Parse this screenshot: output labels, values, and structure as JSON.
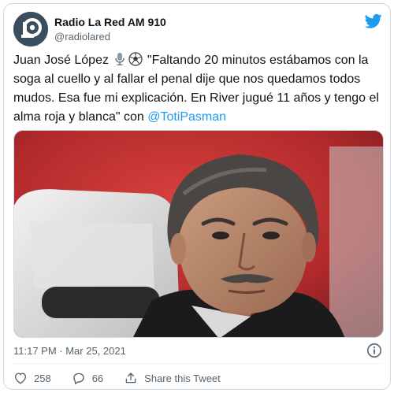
{
  "account": {
    "display_name": "Radio La Red AM 910",
    "handle": "@radiolared",
    "avatar_icon": "radio-la-red-logo",
    "brand_icon": "twitter-bird-icon"
  },
  "tweet": {
    "text_part1": "Juan José López",
    "text_part2": " \"Faltando 20 minutos estábamos con la soga al cuello y al fallar el penal dije que nos quedamos todos mudos. Esa fue mi explicación. En River jugué 11 años y tengo el alma roja y blanca\" con ",
    "mention": "@TotiPasman",
    "emoji": [
      "microphone-emoji",
      "soccer-ball-emoji"
    ]
  },
  "media": {
    "description_icon": "photo-of-man"
  },
  "meta": {
    "timestamp": "11:17 PM · Mar 25, 2021"
  },
  "actions": {
    "likes_count": "258",
    "replies_count": "66",
    "share_label": "Share this Tweet"
  },
  "colors": {
    "link": "#1d9bf0",
    "secondary_text": "#536471",
    "border": "#cfd9de",
    "like_red": "#f91880"
  }
}
